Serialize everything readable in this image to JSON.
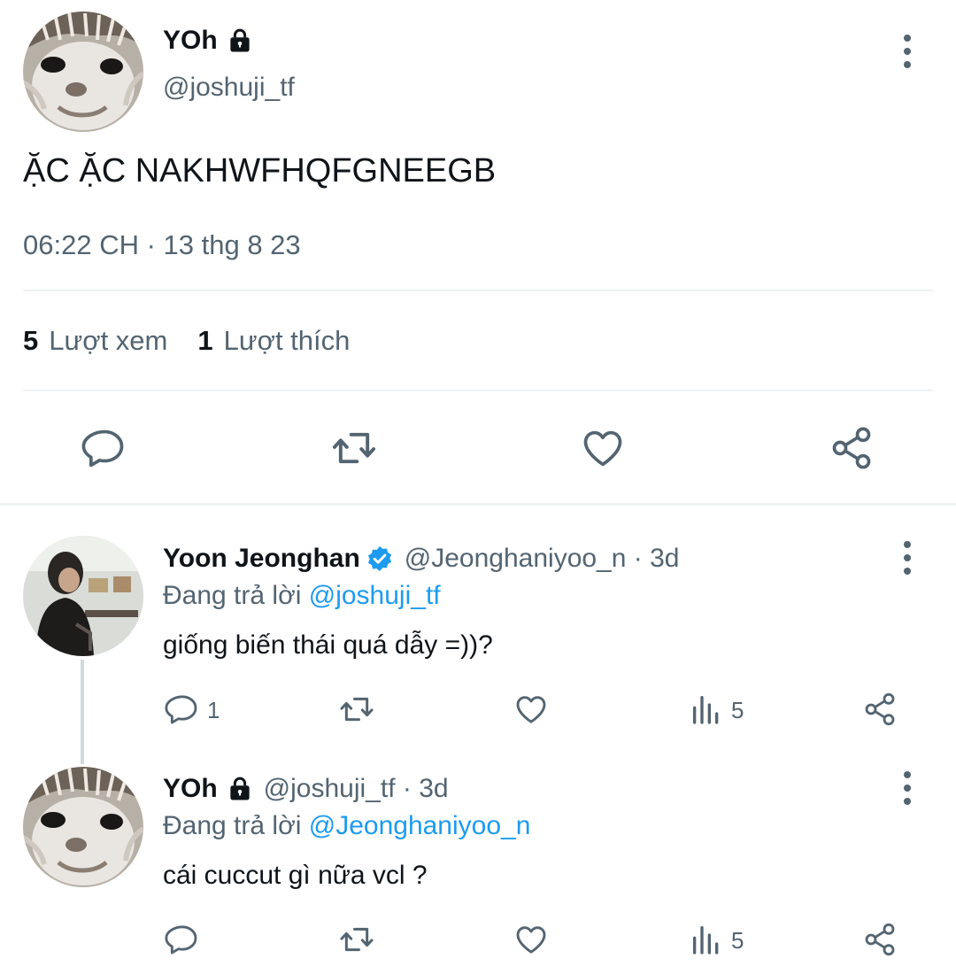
{
  "main_tweet": {
    "author_name": "YOh",
    "author_handle": "@joshuji_tf",
    "text": "ẶC ẶC NAKHWFHQFGNEEGB",
    "timestamp": "06:22 CH · 13 thg 8 23",
    "views_count": "5",
    "views_label": "Lượt xem",
    "likes_count": "1",
    "likes_label": "Lượt thích"
  },
  "replies": [
    {
      "author_name": "Yoon Jeonghan",
      "verified": true,
      "handle_time": "@Jeonghaniyoo_n · 3d",
      "replying_prefix": "Đang trả lời",
      "replying_to": "@joshuji_tf",
      "text": "giống biến thái quá dẫy =))?",
      "reply_count": "1",
      "views_count": "5"
    },
    {
      "author_name": "YOh",
      "verified": false,
      "handle_time": "@joshuji_tf · 3d",
      "replying_prefix": "Đang trả lời",
      "replying_to": "@Jeonghaniyoo_n",
      "text": "cái cuccut gì nữa vcl ?",
      "reply_count": "",
      "views_count": "5"
    }
  ],
  "colors": {
    "text": "#0f1419",
    "secondary": "#536471",
    "accent": "#1d9bf0",
    "divider": "#eff3f4"
  },
  "icons": [
    "lock-icon",
    "verified-icon",
    "more-icon",
    "reply-icon",
    "retweet-icon",
    "like-icon",
    "views-icon",
    "share-icon"
  ]
}
